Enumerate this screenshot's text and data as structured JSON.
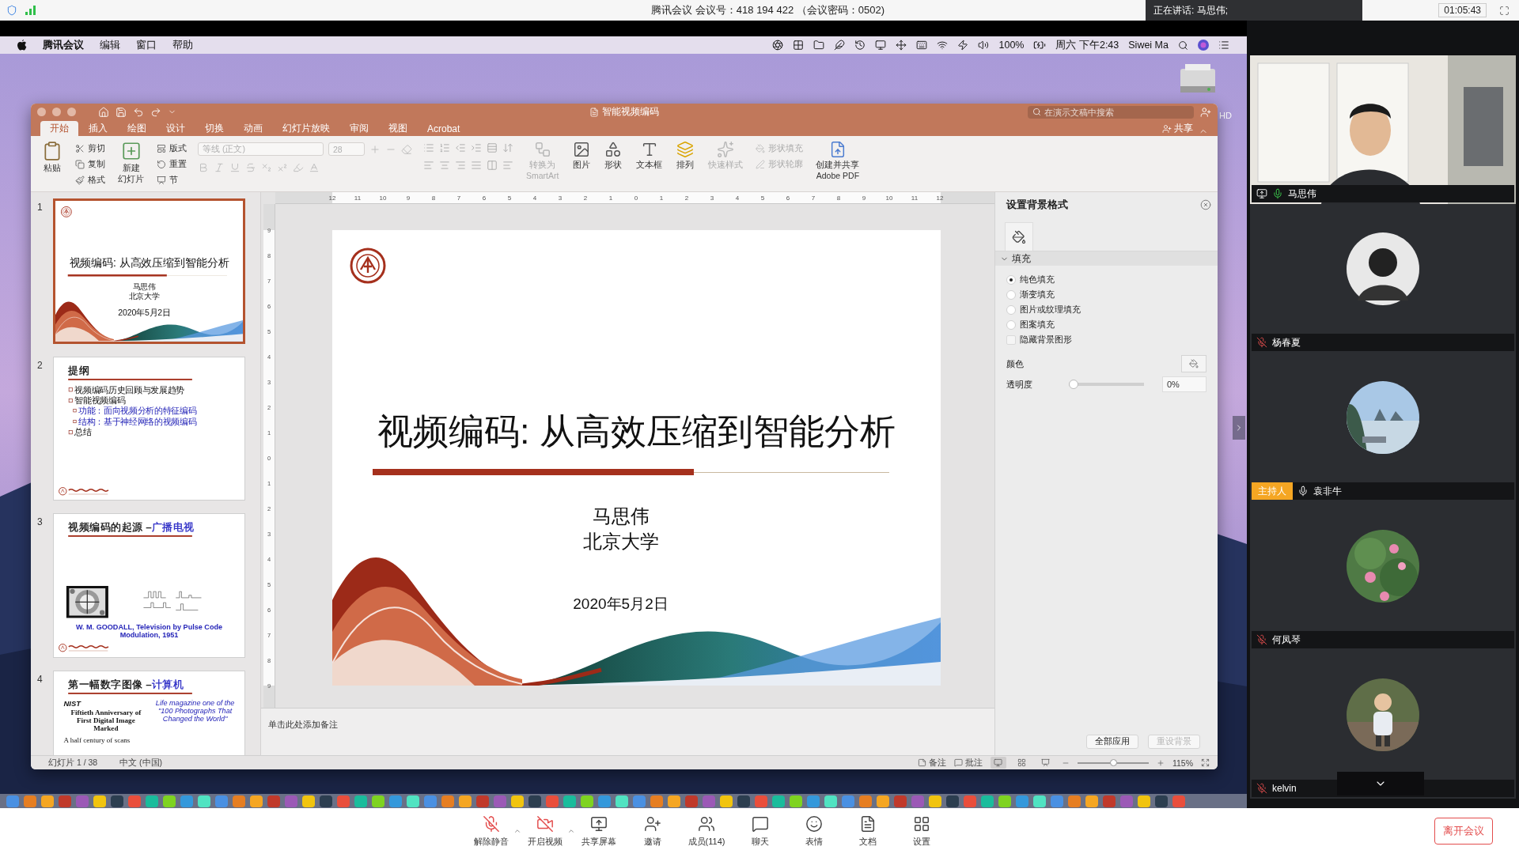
{
  "meeting": {
    "title": "腾讯会议 会议号：418 194 422 （会议密码：0502)",
    "speaking": "正在讲话: 马思伟;",
    "timer": "01:05:43"
  },
  "mac_menu": {
    "app": "腾讯会议",
    "items": [
      "编辑",
      "窗口",
      "帮助"
    ],
    "battery": "100%",
    "clock": "周六 下午2:43",
    "user": "Siwei Ma"
  },
  "desktop": {
    "drive_label": "HD"
  },
  "ppt": {
    "title": "智能视频编码",
    "search_placeholder": "在演示文稿中搜索",
    "share": "共享",
    "tabs": [
      {
        "label": "开始",
        "selected": true
      },
      {
        "label": "插入",
        "selected": false
      },
      {
        "label": "绘图",
        "selected": false
      },
      {
        "label": "设计",
        "selected": false
      },
      {
        "label": "切换",
        "selected": false
      },
      {
        "label": "动画",
        "selected": false
      },
      {
        "label": "幻灯片放映",
        "selected": false
      },
      {
        "label": "审阅",
        "selected": false
      },
      {
        "label": "视图",
        "selected": false
      },
      {
        "label": "Acrobat",
        "selected": false
      }
    ],
    "ribbon": {
      "paste": "粘贴",
      "clipboard": [
        "剪切",
        "复制",
        "格式"
      ],
      "new_slide": [
        "新建",
        "幻灯片"
      ],
      "slide_tools": [
        "版式",
        "重置",
        "节"
      ],
      "font": {
        "name": "等线 (正文)",
        "size": "28",
        "disabled": true
      },
      "tools": [
        {
          "kind": "large",
          "label": [
            "转换为",
            "SmartArt"
          ],
          "disabled": true
        },
        {
          "kind": "large",
          "label": [
            "图片"
          ],
          "disabled": false
        },
        {
          "kind": "large",
          "label": [
            "形状"
          ],
          "disabled": false
        },
        {
          "kind": "large",
          "label": [
            "文本框"
          ],
          "disabled": false
        },
        {
          "kind": "large",
          "label": [
            "排列"
          ],
          "disabled": false
        },
        {
          "kind": "large",
          "label": [
            "快速样式"
          ],
          "disabled": true
        },
        {
          "kind": "stack",
          "items": [
            {
              "label": "形状填充",
              "disabled": true
            },
            {
              "label": "形状轮廓",
              "disabled": true
            }
          ]
        },
        {
          "kind": "large",
          "label": [
            "创建并共享",
            "Adobe PDF"
          ],
          "disabled": false
        }
      ]
    },
    "thumbnails": [
      {
        "number": "1",
        "selected": true,
        "kind": "title",
        "title": "视频编码: 从高效压缩到智能分析",
        "author": "马思伟",
        "org": "北京大学",
        "date": "2020年5月2日"
      },
      {
        "number": "2",
        "selected": false,
        "kind": "outline",
        "title": "提纲",
        "bullets": [
          {
            "text": "视频编码历史回顾与发展趋势"
          },
          {
            "text": "智能视频编码",
            "children": [
              {
                "text": "功能：面向视频分析的特征编码"
              },
              {
                "text": "结构：基于神经网络的视频编码"
              }
            ]
          },
          {
            "text": "总结"
          }
        ]
      },
      {
        "number": "3",
        "selected": false,
        "kind": "figures",
        "title": "视频编码的起源 –",
        "title_highlight": "广播电视",
        "caption": "W. M. GOODALL, Television by Pulse Code Modulation, 1951"
      },
      {
        "number": "4",
        "selected": false,
        "kind": "article",
        "title": "第一幅数字图像 –",
        "title_highlight": "计算机",
        "logo": "NIST",
        "headline": "Fiftieth Anniversary of First Digital Image Marked",
        "quote": "Life magazine one of the \"100 Photographs That Changed the World\"",
        "subhead": "A half century of scans"
      }
    ],
    "ruler": {
      "horizontal": [
        "12",
        "11",
        "10",
        "9",
        "8",
        "7",
        "6",
        "5",
        "4",
        "3",
        "2",
        "1",
        "0",
        "1",
        "2",
        "3",
        "4",
        "5",
        "6",
        "7",
        "8",
        "9",
        "10",
        "11",
        "12"
      ],
      "vertical": [
        "9",
        "8",
        "7",
        "6",
        "5",
        "4",
        "3",
        "2",
        "1",
        "0",
        "1",
        "2",
        "3",
        "4",
        "5",
        "6",
        "7",
        "8",
        "9"
      ]
    },
    "slide": {
      "kind": "title",
      "title": "视频编码: 从高效压缩到智能分析",
      "author": "马思伟",
      "org": "北京大学",
      "date": "2020年5月2日"
    },
    "notes_placeholder": "单击此处添加备注",
    "format_pane": {
      "title": "设置背景格式",
      "section": {
        "label": "填充",
        "expanded": true
      },
      "fills": [
        {
          "label": "纯色填充",
          "selected": true
        },
        {
          "label": "渐变填充",
          "selected": false
        },
        {
          "label": "图片或纹理填充",
          "selected": false
        },
        {
          "label": "图案填充",
          "selected": false
        }
      ],
      "hide_graphics": {
        "label": "隐藏背景图形",
        "checked": false
      },
      "color_label": "颜色",
      "transparency": {
        "label": "透明度",
        "level": 0,
        "value": "0%"
      },
      "buttons": [
        {
          "label": "全部应用",
          "disabled": false
        },
        {
          "label": "重设背景",
          "disabled": true
        }
      ]
    },
    "status": {
      "slide": "幻灯片 1 / 38",
      "language": "中文 (中国)",
      "notes": "备注",
      "comments": "批注",
      "views": [
        {
          "selected": true
        },
        {
          "selected": false
        },
        {
          "selected": false
        }
      ],
      "zoom": {
        "level": 0.5,
        "value": "115%"
      }
    }
  },
  "participants": [
    {
      "name": "马思伟",
      "kind": "video",
      "muted": false,
      "speaking": true,
      "sharing": true
    },
    {
      "name": "杨春夏",
      "kind": "avatar",
      "muted": true,
      "speaking": false,
      "sharing": false
    },
    {
      "name": "袁非牛",
      "kind": "avatar",
      "muted": false,
      "speaking": false,
      "sharing": false,
      "badge": "主持人"
    },
    {
      "name": "何凤琴",
      "kind": "avatar",
      "muted": true,
      "speaking": false,
      "sharing": false
    },
    {
      "name": "kelvin",
      "kind": "avatar",
      "muted": true,
      "speaking": false,
      "sharing": false
    }
  ],
  "toolbar": [
    {
      "label": "解除静音",
      "caret": true
    },
    {
      "label": "开启视频",
      "caret": true
    },
    {
      "label": "共享屏幕",
      "caret": false
    },
    {
      "label": "邀请",
      "caret": false
    },
    {
      "label": "成员(114)",
      "caret": false
    },
    {
      "label": "聊天",
      "caret": false
    },
    {
      "label": "表情",
      "caret": false
    },
    {
      "label": "文档",
      "caret": false
    },
    {
      "label": "设置",
      "caret": false
    }
  ],
  "leave": "离开会议"
}
